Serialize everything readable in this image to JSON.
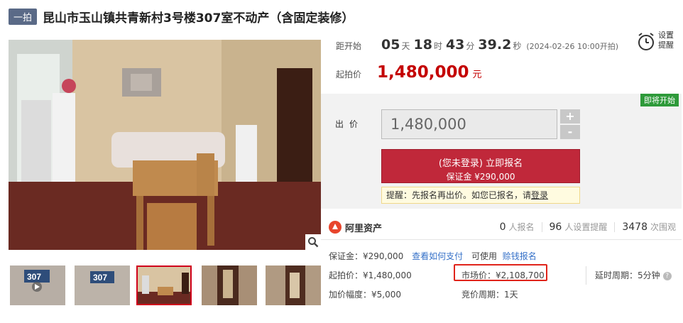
{
  "header": {
    "badge": "一拍",
    "title": "昆山市玉山镇共青新村3号楼307室不动产（含固定装修）"
  },
  "countdown": {
    "label": "距开始",
    "days": "05",
    "days_unit": "天",
    "hours": "18",
    "hours_unit": "时",
    "minutes": "43",
    "minutes_unit": "分",
    "seconds": "39.2",
    "seconds_unit": "秒",
    "start_note": "(2024-02-26 10:00开拍)"
  },
  "start_price": {
    "label": "起拍价",
    "value": "1,480,000",
    "unit": "元"
  },
  "reminder": {
    "line1": "设置",
    "line2": "提醒"
  },
  "bid": {
    "status_tag": "即将开始",
    "label": "出价",
    "amount": "1,480,000",
    "plus": "+",
    "minus": "-",
    "signup_main": "(您未登录) 立即报名",
    "signup_sub": "保证金 ¥290,000",
    "notice_prefix": "提醒：先报名再出价。如您已报名，请",
    "notice_link": "登录"
  },
  "stats": {
    "brand": "阿里资产",
    "signups": "0",
    "signups_label": "人报名",
    "reminders": "96",
    "reminders_label": "人设置提醒",
    "views": "3478",
    "views_label": "次围观"
  },
  "details": {
    "deposit": "保证金：¥290,000",
    "how_to_pay": "查看如何支付",
    "usable_prefix": "可使用",
    "insurance": "赊钱报名",
    "start_price": "起拍价：¥1,480,000",
    "market_price": "市场价：¥2,108,700",
    "delay_period": "延时周期：5分钟",
    "increment": "加价幅度：¥5,000",
    "bid_period": "竞价周期：1天"
  },
  "thumbnails": [
    {
      "label": "307"
    },
    {
      "label": "307"
    },
    {
      "label": ""
    },
    {
      "label": ""
    },
    {
      "label": ""
    }
  ],
  "colors": {
    "accent_red": "#c0283a",
    "price_red": "#c40000",
    "link_blue": "#3470c8",
    "tag_green": "#2e9a3a",
    "badge_slate": "#5a6a87"
  }
}
